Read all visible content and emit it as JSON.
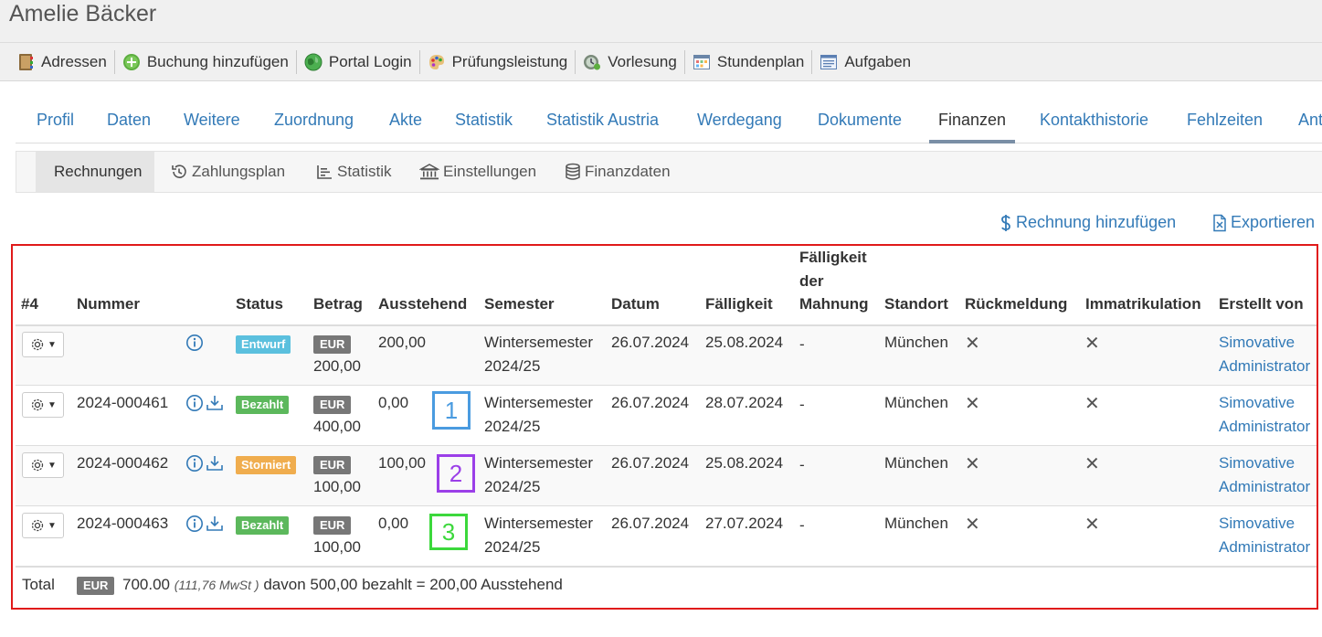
{
  "window": {
    "title": "Amelie Bäcker"
  },
  "toolbar": {
    "items": [
      {
        "label": "Adressen",
        "icon": "address-book-icon"
      },
      {
        "label": "Buchung hinzufügen",
        "icon": "add-circle-icon"
      },
      {
        "label": "Portal Login",
        "icon": "globe-icon"
      },
      {
        "label": "Prüfungsleistung",
        "icon": "palette-icon"
      },
      {
        "label": "Vorlesung",
        "icon": "lecture-icon"
      },
      {
        "label": "Stundenplan",
        "icon": "calendar-icon"
      },
      {
        "label": "Aufgaben",
        "icon": "task-list-icon"
      }
    ]
  },
  "main_tabs": [
    "Profil",
    "Daten",
    "Weitere",
    "Zuordnung",
    "Akte",
    "Statistik",
    "Statistik Austria",
    "Werdegang",
    "Dokumente",
    "Finanzen",
    "Kontakthistorie",
    "Fehlzeiten",
    "Ant"
  ],
  "active_main_tab": "Finanzen",
  "sub_tabs": [
    "Rechnungen",
    "Zahlungsplan",
    "Statistik",
    "Einstellungen",
    "Finanzdaten"
  ],
  "active_sub_tab": "Rechnungen",
  "actions": {
    "add_invoice": "Rechnung hinzufügen",
    "export": "Exportieren"
  },
  "table": {
    "headers": {
      "count": "#4",
      "number": "Nummer",
      "status": "Status",
      "amount": "Betrag",
      "outstanding": "Ausstehend",
      "semester": "Semester",
      "date": "Datum",
      "due": "Fälligkeit",
      "dunning_due_1": "Fälligkeit",
      "dunning_due_2": "der",
      "dunning_due_3": "Mahnung",
      "location": "Standort",
      "feedback": "Rückmeldung",
      "enrollment": "Immatrikulation",
      "created_by": "Erstellt von"
    },
    "rows": [
      {
        "number": "",
        "status": "Entwurf",
        "status_color": "#5bc0de",
        "currency": "EUR",
        "amount": "200,00",
        "outstanding": "200,00",
        "semester_1": "Wintersemester",
        "semester_2": "2024/25",
        "date": "26.07.2024",
        "due": "25.08.2024",
        "dunning": "-",
        "location": "München",
        "feedback": "✕",
        "enrollment": "✕",
        "creator_1": "Simovative",
        "creator_2": "Administrator",
        "has_download": false
      },
      {
        "number": "2024-000461",
        "status": "Bezahlt",
        "status_color": "#5cb85c",
        "currency": "EUR",
        "amount": "400,00",
        "outstanding": "0,00",
        "semester_1": "Wintersemester",
        "semester_2": "2024/25",
        "date": "26.07.2024",
        "due": "28.07.2024",
        "dunning": "-",
        "location": "München",
        "feedback": "✕",
        "enrollment": "✕",
        "creator_1": "Simovative",
        "creator_2": "Administrator",
        "has_download": true
      },
      {
        "number": "2024-000462",
        "status": "Storniert",
        "status_color": "#f0ad4e",
        "currency": "EUR",
        "amount": "100,00",
        "outstanding": "100,00",
        "semester_1": "Wintersemester",
        "semester_2": "2024/25",
        "date": "26.07.2024",
        "due": "25.08.2024",
        "dunning": "-",
        "location": "München",
        "feedback": "✕",
        "enrollment": "✕",
        "creator_1": "Simovative",
        "creator_2": "Administrator",
        "has_download": true
      },
      {
        "number": "2024-000463",
        "status": "Bezahlt",
        "status_color": "#5cb85c",
        "currency": "EUR",
        "amount": "100,00",
        "outstanding": "0,00",
        "semester_1": "Wintersemester",
        "semester_2": "2024/25",
        "date": "26.07.2024",
        "due": "27.07.2024",
        "dunning": "-",
        "location": "München",
        "feedback": "✕",
        "enrollment": "✕",
        "creator_1": "Simovative",
        "creator_2": "Administrator",
        "has_download": true
      }
    ],
    "total": {
      "label": "Total",
      "currency": "EUR",
      "amount": "700.00",
      "vat": "(111,76 MwSt )",
      "rest": "davon 500,00 bezahlt = 200,00 Ausstehend"
    }
  },
  "annotations": [
    {
      "label": "1",
      "color": "#4a9be0"
    },
    {
      "label": "2",
      "color": "#9b3fe8"
    },
    {
      "label": "3",
      "color": "#3cd83c"
    }
  ]
}
